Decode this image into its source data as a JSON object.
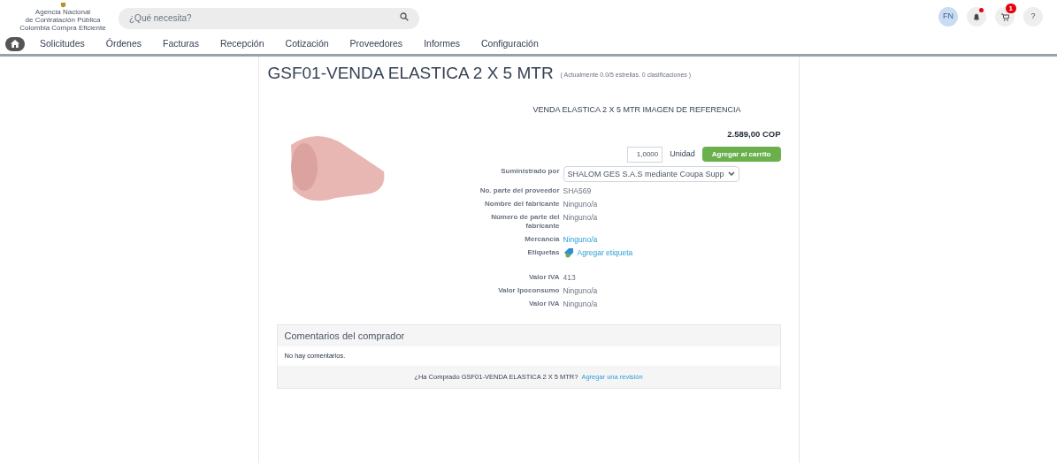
{
  "header": {
    "logo_lines": [
      "Agencia Nacional",
      "de Contratación Pública",
      "Colombia Compra Eficiente"
    ],
    "search": {
      "placeholder": "¿Qué necesita?"
    },
    "user_initials": "FN",
    "notifications": {
      "unread": true
    },
    "cart": {
      "count": "1"
    },
    "help": "?"
  },
  "nav": [
    {
      "label": "Solicitudes",
      "selected": false
    },
    {
      "label": "Órdenes",
      "selected": false
    },
    {
      "label": "Facturas",
      "selected": false
    },
    {
      "label": "Recepción",
      "selected": false
    },
    {
      "label": "Cotización",
      "selected": false
    },
    {
      "label": "Proveedores",
      "selected": false
    },
    {
      "label": "Informes",
      "selected": false
    },
    {
      "label": "Configuración",
      "selected": false
    }
  ],
  "product": {
    "title": "GSF01-VENDA ELASTICA 2 X 5 MTR",
    "rating_note": "( Actualmente 0.0/5 estrellas. 0 clasificaciones )",
    "image_caption": "VENDA ELASTICA 2 X 5 MTR IMAGEN DE REFERENCIA",
    "price": "2.589,00 COP",
    "quantity": "1,0000",
    "unit": "Unidad",
    "add_button": "Agregar al carrito",
    "details": [
      {
        "kind": "select",
        "label": "Suministrado por",
        "value": "SHALOM GES S.A.S mediante Coupa Supp"
      },
      {
        "kind": "text",
        "label": "No. parte del proveedor",
        "value": "SHA569"
      },
      {
        "kind": "text",
        "label": "Nombre del fabricante",
        "value": "Ninguno/a"
      },
      {
        "kind": "text",
        "label": "Número de parte del fabricante",
        "value": "Ninguno/a"
      },
      {
        "kind": "link",
        "label": "Mercancía",
        "value": "Ninguno/a"
      },
      {
        "kind": "tag",
        "label": "Etiquetas",
        "value": "Agregar etiqueta"
      },
      {
        "kind": "text",
        "label": "Valor IVA",
        "value": "413"
      },
      {
        "kind": "text",
        "label": "Valor Ipoconsumo",
        "value": "Ninguno/a"
      },
      {
        "kind": "text",
        "label": "Valor IVA",
        "value": "Ninguno/a"
      }
    ]
  },
  "comments": {
    "title": "Comentarios del comprador",
    "empty": "No hay comentarios.",
    "question": "¿Ha Comprado GSF01-VENDA ELASTICA 2 X 5 MTR?",
    "review_link": "Agregar una revisión"
  }
}
